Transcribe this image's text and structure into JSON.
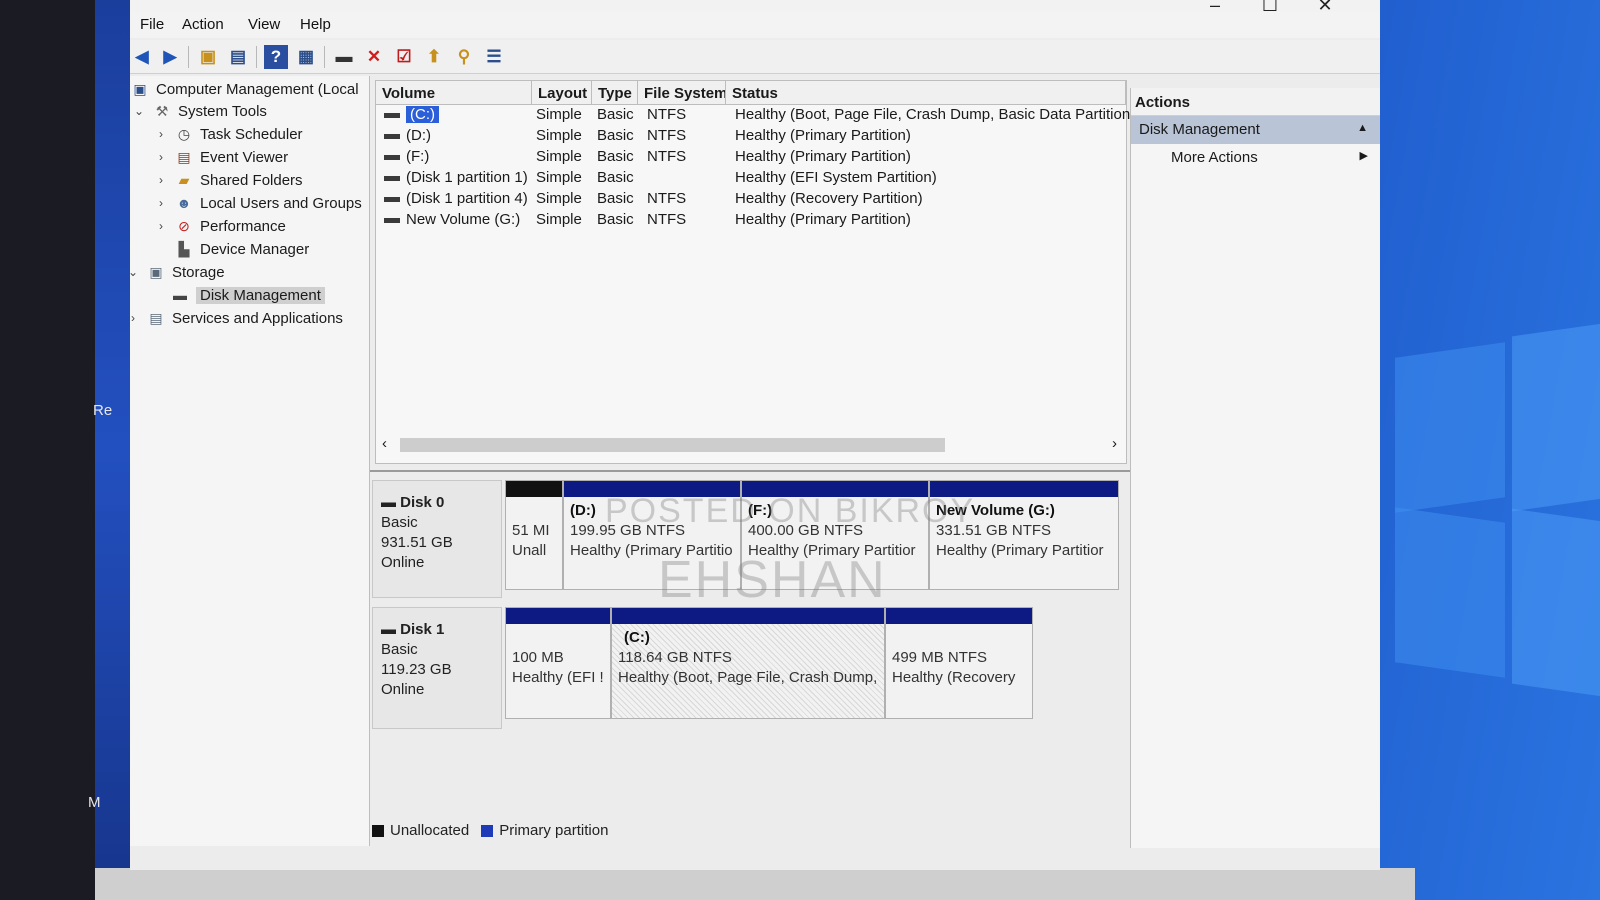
{
  "window": {
    "minimize": "–",
    "maximize": "☐",
    "close": "✕"
  },
  "menu": [
    "File",
    "Action",
    "View",
    "Help"
  ],
  "tree": {
    "root": "Computer Management (Local",
    "system_tools": "System Tools",
    "task_scheduler": "Task Scheduler",
    "event_viewer": "Event Viewer",
    "shared_folders": "Shared Folders",
    "local_users": "Local Users and Groups",
    "performance": "Performance",
    "device_manager": "Device Manager",
    "storage": "Storage",
    "disk_management": "Disk Management",
    "services": "Services and Applications"
  },
  "volume_list": {
    "headers": [
      "Volume",
      "Layout",
      "Type",
      "File System",
      "Status"
    ],
    "rows": [
      {
        "volume": "(C:)",
        "layout": "Simple",
        "type": "Basic",
        "fs": "NTFS",
        "status": "Healthy (Boot, Page File, Crash Dump, Basic Data Partition)"
      },
      {
        "volume": "(D:)",
        "layout": "Simple",
        "type": "Basic",
        "fs": "NTFS",
        "status": "Healthy (Primary Partition)"
      },
      {
        "volume": "(F:)",
        "layout": "Simple",
        "type": "Basic",
        "fs": "NTFS",
        "status": "Healthy (Primary Partition)"
      },
      {
        "volume": "(Disk 1 partition 1)",
        "layout": "Simple",
        "type": "Basic",
        "fs": "",
        "status": "Healthy (EFI System Partition)"
      },
      {
        "volume": "(Disk 1 partition 4)",
        "layout": "Simple",
        "type": "Basic",
        "fs": "NTFS",
        "status": "Healthy (Recovery Partition)"
      },
      {
        "volume": "New Volume (G:)",
        "layout": "Simple",
        "type": "Basic",
        "fs": "NTFS",
        "status": "Healthy (Primary Partition)"
      }
    ]
  },
  "disks": {
    "disk0": {
      "name": "Disk 0",
      "type": "Basic",
      "size": "931.51 GB",
      "state": "Online",
      "parts": [
        {
          "title": "",
          "line1": "51 MI",
          "line2": "Unall"
        },
        {
          "title": "(D:)",
          "line1": "199.95 GB NTFS",
          "line2": "Healthy (Primary Partitio"
        },
        {
          "title": "(F:)",
          "line1": "400.00 GB NTFS",
          "line2": "Healthy (Primary Partitior"
        },
        {
          "title": "New Volume  (G:)",
          "line1": "331.51 GB NTFS",
          "line2": "Healthy (Primary Partitior"
        }
      ]
    },
    "disk1": {
      "name": "Disk 1",
      "type": "Basic",
      "size": "119.23 GB",
      "state": "Online",
      "parts": [
        {
          "title": "",
          "line1": "100 MB",
          "line2": "Healthy (EFI !"
        },
        {
          "title": "(C:)",
          "line1": "118.64 GB NTFS",
          "line2": "Healthy (Boot, Page File, Crash Dump,"
        },
        {
          "title": "",
          "line1": "499 MB NTFS",
          "line2": "Healthy (Recovery"
        }
      ]
    }
  },
  "legend": {
    "unallocated": "Unallocated",
    "primary": "Primary partition"
  },
  "actions": {
    "header": "Actions",
    "section": "Disk Management",
    "more": "More Actions"
  },
  "watermark": {
    "line1": "POSTED ON BIKROY",
    "line2": "EHSHAN"
  },
  "desktop_labels": [
    "Re",
    "M"
  ],
  "colors": {
    "primary_partition": "#0e1a84",
    "unallocated": "#111111",
    "selection": "#2b5fd9"
  }
}
